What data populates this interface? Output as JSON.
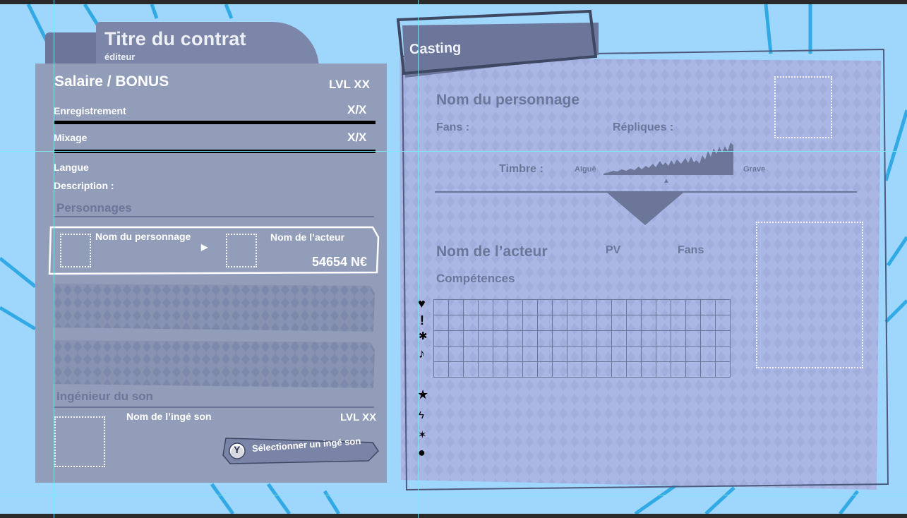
{
  "contract": {
    "title": "Titre du contrat",
    "subtitle": "éditeur",
    "salary_label": "Salaire / BONUS",
    "level": "LVL XX",
    "recording_label": "Enregistrement",
    "recording_value": "X/X",
    "mixing_label": "Mixage",
    "mixing_value": "X/X",
    "language_label": "Langue",
    "description_label": "Description :",
    "characters_header": "Personnages",
    "card_character_name": "Nom du personnage",
    "card_actor_name": "Nom de l’acteur",
    "card_price": "54654 N€",
    "engineer_header": "Ingénieur du son",
    "engineer_name": "Nom de l’ingé son",
    "engineer_level": "LVL XX",
    "select_button_label": "Sélectionner un ingé son",
    "select_button_key": "Y"
  },
  "casting": {
    "tab_label": "Casting",
    "character_name": "Nom du personnage",
    "fans_label": "Fans :",
    "lines_label": "Répliques :",
    "timbre_label": "Timbre :",
    "timbre_high": "Aiguë",
    "timbre_low": "Grave",
    "actor_name": "Nom de l’acteur",
    "pv_label": "PV",
    "actor_fans_label": "Fans",
    "skills_label": "Compétences",
    "skill_icons": [
      "heart-icon",
      "exclamation-icon",
      "bug-icon",
      "music-note-icon"
    ],
    "extra_icons": [
      "star-icon",
      "lightning-icon",
      "burst-icon",
      "drop-icon"
    ]
  },
  "colors": {
    "background": "#9fd6fb",
    "panel": "#929db9",
    "panel_dark": "#6b7699",
    "casting_panel": "#a9b6e2"
  }
}
